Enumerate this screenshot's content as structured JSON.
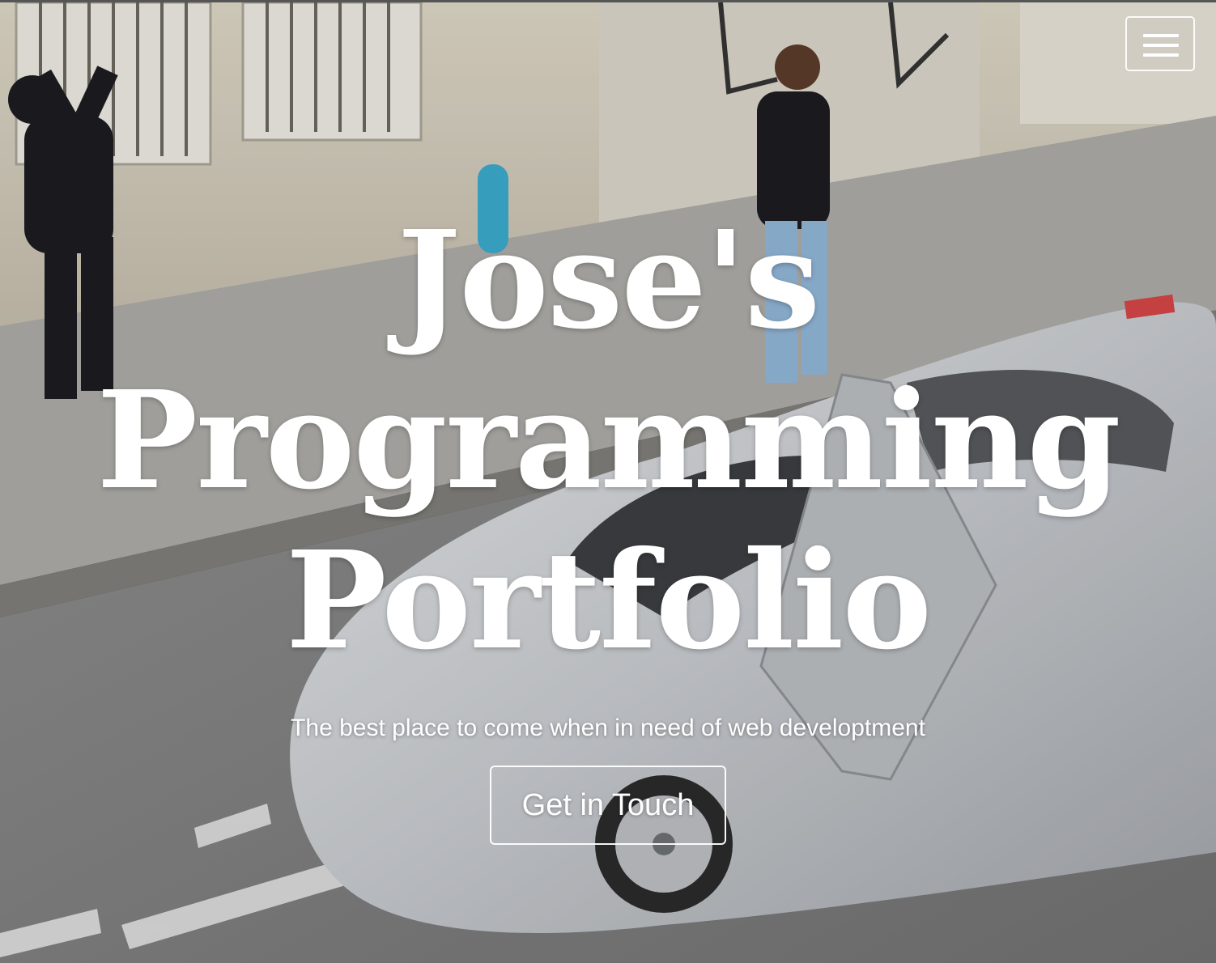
{
  "hero": {
    "title_line_1": "Jose's",
    "title_line_2": "Programming",
    "title_line_3": "Portfolio",
    "subtitle": "The best place to come when in need of web developtment",
    "cta_label": "Get in Touch",
    "background_image": "street-scene-photo"
  },
  "navbar": {
    "toggle_icon": "hamburger-icon"
  },
  "colors": {
    "text": "#ffffff",
    "button_border": "#ffffff"
  }
}
